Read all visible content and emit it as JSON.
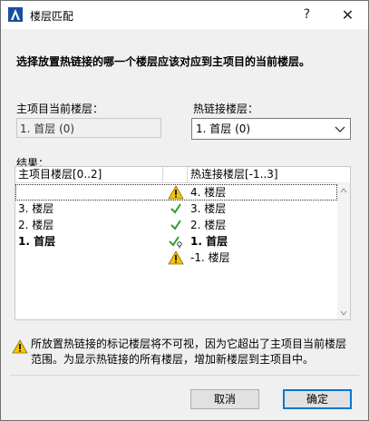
{
  "window": {
    "title": "楼层匹配",
    "help_label": "?",
    "close_label": "✕"
  },
  "prompt": "选择放置热链接的哪一个楼层应该对应到主项目的当前楼层。",
  "host_story": {
    "label": "主项目当前楼层：",
    "value": "1. 首层 (0)"
  },
  "hotlink_story": {
    "label": "热链接楼层：",
    "value": "1. 首层 (0)"
  },
  "results": {
    "label": "结果：",
    "col_host": "主项目楼层[0..2]",
    "col_hotlink": "热连接楼层[-1..3]",
    "rows": [
      {
        "host": "",
        "status": "warning-icon",
        "hotlink": "4. 楼层",
        "bold": false,
        "selected": true
      },
      {
        "host": "3. 楼层",
        "status": "check-icon",
        "hotlink": "3. 楼层",
        "bold": false,
        "selected": false
      },
      {
        "host": "2. 楼层",
        "status": "check-icon",
        "hotlink": "2. 楼层",
        "bold": false,
        "selected": false
      },
      {
        "host": "1. 首层",
        "status": "check-anchor-icon",
        "hotlink": "1. 首层",
        "bold": true,
        "selected": false
      },
      {
        "host": "",
        "status": "warning-icon",
        "hotlink": "-1. 楼层",
        "bold": false,
        "selected": false
      }
    ]
  },
  "warning": {
    "icon": "warning-icon",
    "text": "所放置热链接的标记楼层将不可视，因为它超出了主项目当前楼层范围。为显示热链接的所有楼层，增加新楼层到主项目中。"
  },
  "buttons": {
    "cancel": "取消",
    "ok": "确定"
  },
  "colors": {
    "accent": "#0078d7",
    "check": "#2e9e2e",
    "warning": "#f5c400"
  }
}
